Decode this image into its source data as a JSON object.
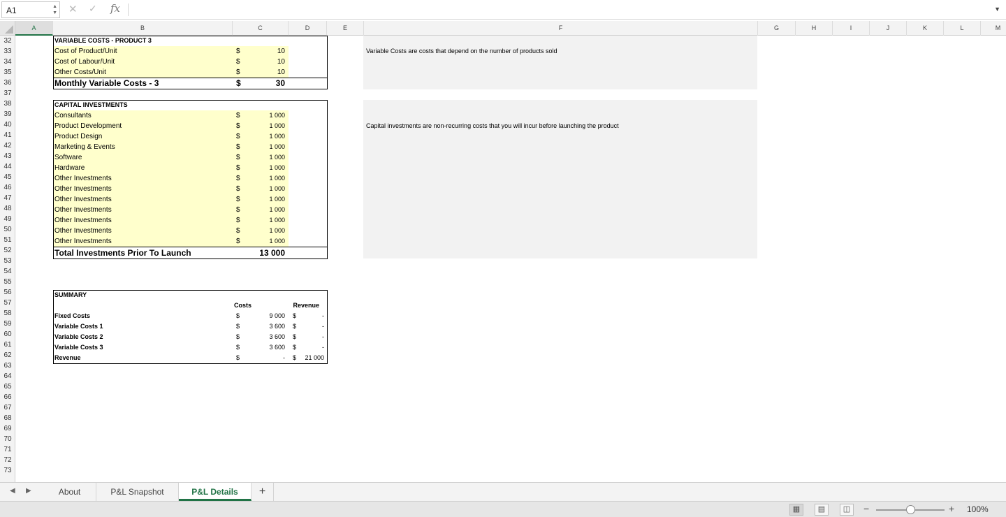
{
  "formula_bar": {
    "name_box": "A1",
    "cancel_icon": "close-icon",
    "confirm_icon": "check-icon",
    "fx_label": "fx",
    "content": ""
  },
  "columns": [
    "A",
    "B",
    "C",
    "D",
    "E",
    "F",
    "G",
    "H",
    "I",
    "J",
    "K",
    "L",
    "M"
  ],
  "selected_column": "A",
  "rows": [
    32,
    33,
    34,
    35,
    36,
    37,
    38,
    39,
    40,
    41,
    42,
    43,
    44,
    45,
    46,
    47,
    48,
    49,
    50,
    51,
    52,
    53,
    54,
    55,
    56,
    57,
    58,
    59,
    60,
    61,
    62,
    63,
    64,
    65,
    66,
    67,
    68,
    69,
    70,
    71,
    72,
    73
  ],
  "variable_costs": {
    "title": "VARIABLE COSTS - PRODUCT 3",
    "items": [
      {
        "label": "Cost of Product/Unit",
        "currency": "$",
        "value": "10"
      },
      {
        "label": "Cost of Labour/Unit",
        "currency": "$",
        "value": "10"
      },
      {
        "label": "Other Costs/Unit",
        "currency": "$",
        "value": "10"
      }
    ],
    "total_label": "Monthly Variable Costs - 3",
    "total_currency": "$",
    "total_value": "30",
    "note": "Variable Costs are costs that depend on the number of products sold"
  },
  "capital_investments": {
    "title": "CAPITAL INVESTMENTS",
    "items": [
      {
        "label": "Consultants",
        "currency": "$",
        "value": "1 000"
      },
      {
        "label": "Product Development",
        "currency": "$",
        "value": "1 000"
      },
      {
        "label": "Product Design",
        "currency": "$",
        "value": "1 000"
      },
      {
        "label": "Marketing & Events",
        "currency": "$",
        "value": "1 000"
      },
      {
        "label": "Software",
        "currency": "$",
        "value": "1 000"
      },
      {
        "label": "Hardware",
        "currency": "$",
        "value": "1 000"
      },
      {
        "label": "Other Investments",
        "currency": "$",
        "value": "1 000"
      },
      {
        "label": "Other Investments",
        "currency": "$",
        "value": "1 000"
      },
      {
        "label": "Other Investments",
        "currency": "$",
        "value": "1 000"
      },
      {
        "label": "Other Investments",
        "currency": "$",
        "value": "1 000"
      },
      {
        "label": "Other Investments",
        "currency": "$",
        "value": "1 000"
      },
      {
        "label": "Other Investments",
        "currency": "$",
        "value": "1 000"
      },
      {
        "label": "Other Investments",
        "currency": "$",
        "value": "1 000"
      }
    ],
    "total_label": "Total Investments Prior To Launch",
    "total_value": "13 000",
    "note": "Capital investments are non-recurring costs that you will incur before launching the product"
  },
  "summary": {
    "title": "SUMMARY",
    "costs_header": "Costs",
    "revenue_header": "Revenue",
    "rows": [
      {
        "label": "Fixed Costs",
        "cost_currency": "$",
        "cost": "9 000",
        "rev_currency": "$",
        "revenue": "-"
      },
      {
        "label": "Variable Costs 1",
        "cost_currency": "$",
        "cost": "3 600",
        "rev_currency": "$",
        "revenue": "-"
      },
      {
        "label": "Variable Costs 2",
        "cost_currency": "$",
        "cost": "3 600",
        "rev_currency": "$",
        "revenue": "-"
      },
      {
        "label": "Variable Costs 3",
        "cost_currency": "$",
        "cost": "3 600",
        "rev_currency": "$",
        "revenue": "-"
      },
      {
        "label": "Revenue",
        "cost_currency": "$",
        "cost": "-",
        "rev_currency": "$",
        "revenue": "21 000"
      }
    ]
  },
  "sheet_tabs": [
    {
      "label": "About",
      "active": false
    },
    {
      "label": "P&L Snapshot",
      "active": false
    },
    {
      "label": "P&L Details",
      "active": true
    }
  ],
  "add_sheet_label": "+",
  "status_bar": {
    "view_icons": [
      "normal-view-icon",
      "page-layout-icon",
      "page-break-icon"
    ],
    "zoom_minus": "−",
    "zoom_plus": "+",
    "zoom_level": "100%",
    "zoom_fraction": 0.5
  },
  "colors": {
    "accent": "#217346",
    "input_fill": "#ffffcc",
    "note_fill": "#f2f2f2"
  }
}
